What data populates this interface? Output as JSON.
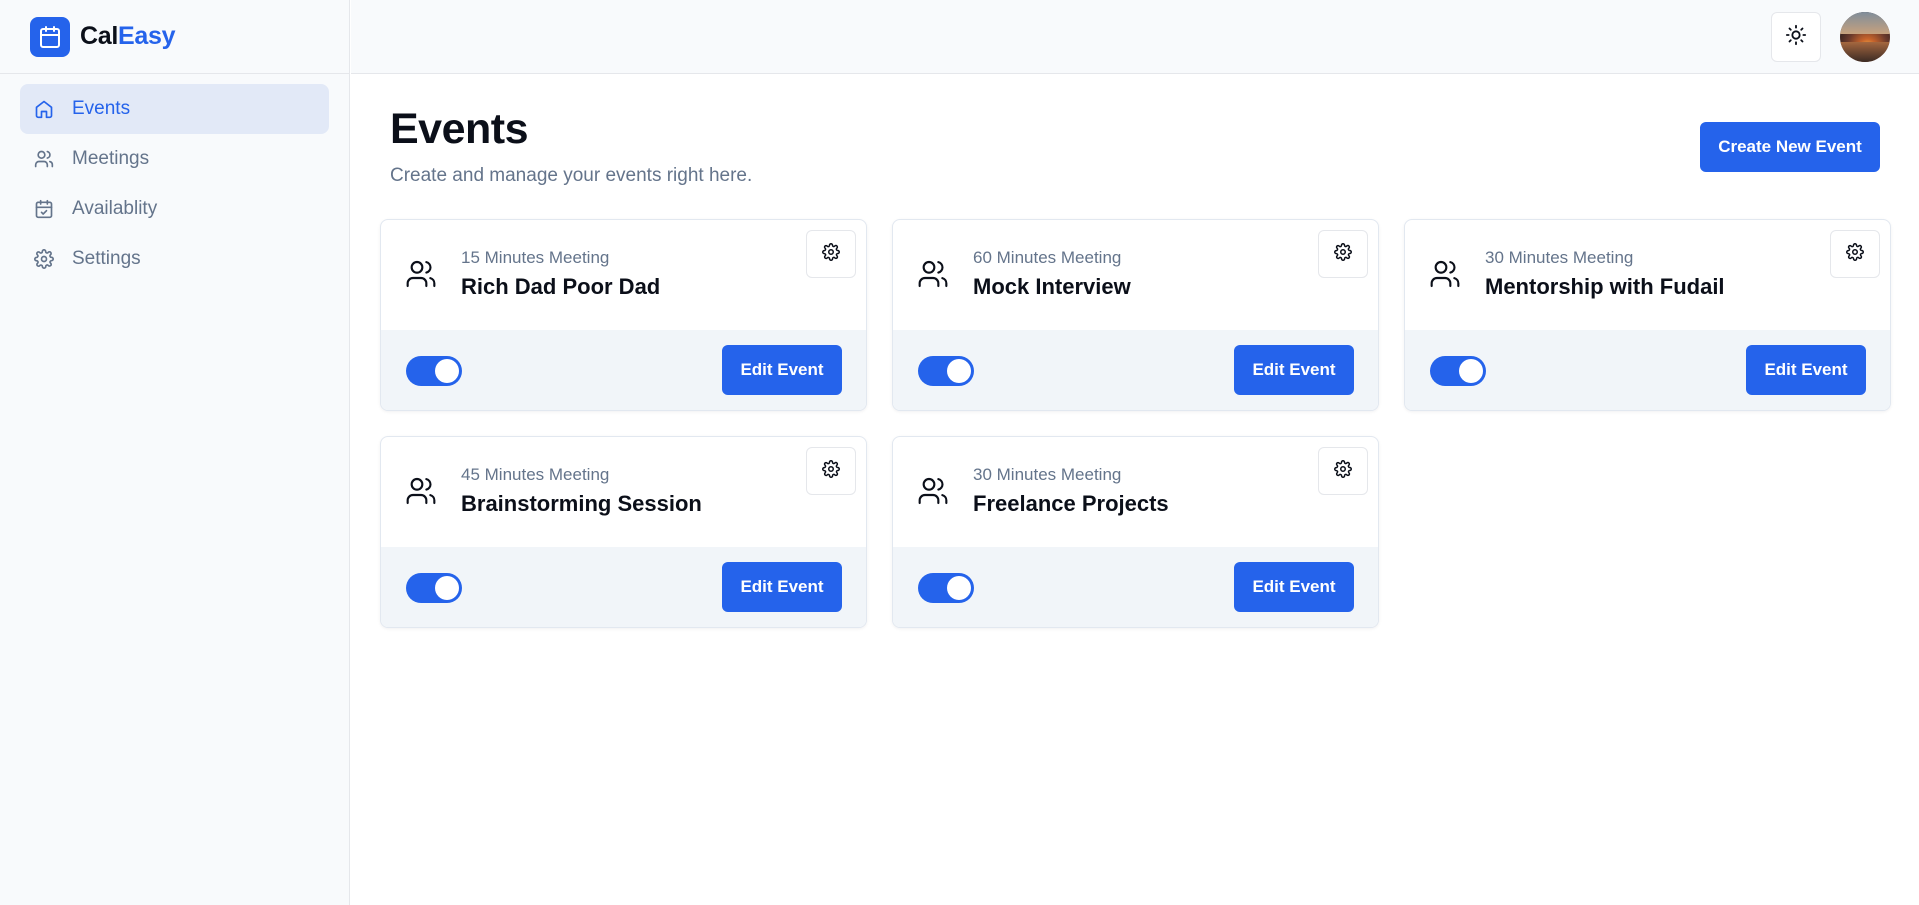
{
  "app": {
    "name_part1": "Cal",
    "name_part2": "Easy",
    "accent_color": "#2563eb"
  },
  "sidebar": {
    "items": [
      {
        "label": "Events",
        "icon": "home-icon",
        "active": true
      },
      {
        "label": "Meetings",
        "icon": "users-icon",
        "active": false
      },
      {
        "label": "Availablity",
        "icon": "calendar-check-icon",
        "active": false
      },
      {
        "label": "Settings",
        "icon": "gear-icon",
        "active": false
      }
    ]
  },
  "topbar": {
    "theme_toggle_icon": "sun-icon",
    "avatar_icon": "user-avatar"
  },
  "main": {
    "title": "Events",
    "subtitle": "Create and manage your events right here.",
    "create_button_label": "Create New Event"
  },
  "events": [
    {
      "duration": "15 Minutes Meeting",
      "title": "Rich Dad Poor Dad",
      "enabled": true,
      "edit_label": "Edit Event"
    },
    {
      "duration": "60 Minutes Meeting",
      "title": "Mock Interview",
      "enabled": true,
      "edit_label": "Edit Event"
    },
    {
      "duration": "30 Minutes Meeting",
      "title": "Mentorship with Fudail",
      "enabled": true,
      "edit_label": "Edit Event"
    },
    {
      "duration": "45 Minutes Meeting",
      "title": "Brainstorming Session",
      "enabled": true,
      "edit_label": "Edit Event"
    },
    {
      "duration": "30 Minutes Meeting",
      "title": "Freelance Projects",
      "enabled": true,
      "edit_label": "Edit Event"
    }
  ]
}
